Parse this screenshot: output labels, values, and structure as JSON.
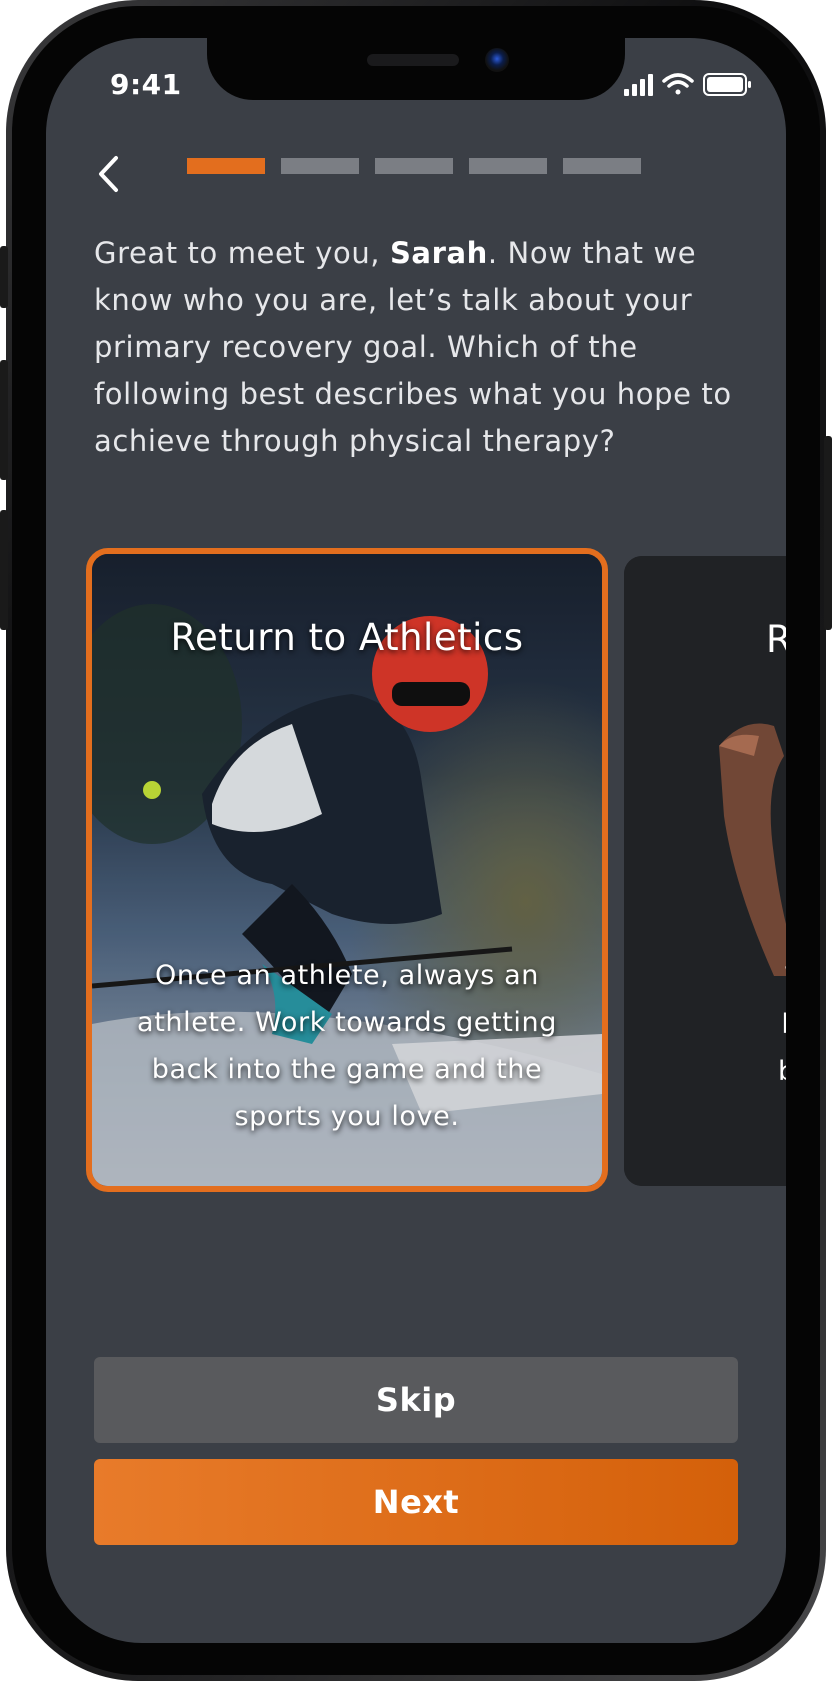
{
  "status_bar": {
    "time": "9:41"
  },
  "onboarding": {
    "progress": {
      "total_steps": 5,
      "current_step": 1
    },
    "intro": {
      "before_name": "Great to meet you, ",
      "name": "Sarah",
      "after_name": ". Now that we know who you are, let’s talk about your primary recovery goal. Which of the following best describes what you hope to achieve through physical therapy?"
    },
    "cards": [
      {
        "title": "Return to Athletics",
        "description": "Once an athlete, always an athlete. Work towards getting back into the game and the sports you love.",
        "selected": true
      },
      {
        "title": "R",
        "description": "Work t\nlimited\nback to",
        "selected": false
      }
    ],
    "skip_label": "Skip",
    "next_label": "Next"
  },
  "colors": {
    "accent": "#e36e1e",
    "screen_bg": "#3b3f46",
    "inactive_segment": "#7b7e84",
    "skip_bg": "#595a5d"
  }
}
